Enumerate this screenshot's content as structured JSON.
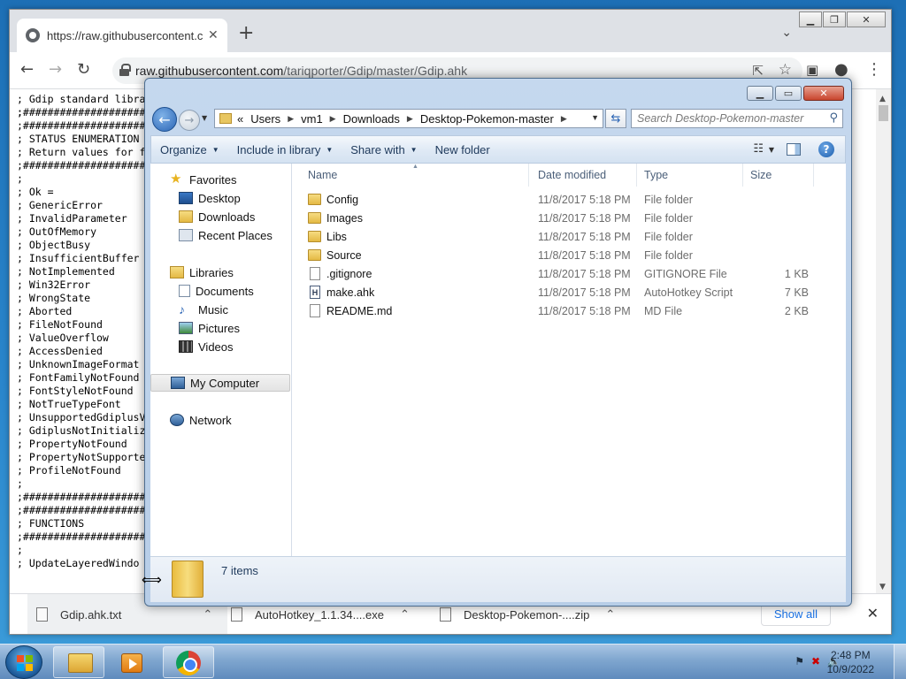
{
  "chrome": {
    "tab_title": "https://raw.githubusercontent.co",
    "url_host": "raw.githubusercontent.com",
    "url_path": "/tariqporter/Gdip/master/Gdip.ahk",
    "page_lines": [
      "; Gdip standard libra",
      ";",
      ";#####################",
      ";#####################",
      "; STATUS ENUMERATION",
      "; Return values for f",
      ";#####################",
      ";",
      "; Ok =",
      "; GenericError",
      "; InvalidParameter",
      "; OutOfMemory",
      "; ObjectBusy",
      "; InsufficientBuffer",
      "; NotImplemented",
      "; Win32Error",
      "; WrongState",
      "; Aborted",
      "; FileNotFound",
      "; ValueOverflow",
      "; AccessDenied",
      "; UnknownImageFormat",
      "; FontFamilyNotFound",
      "; FontStyleNotFound",
      "; NotTrueTypeFont",
      "; UnsupportedGdiplusV",
      "; GdiplusNotInitializ",
      "; PropertyNotFound",
      "; PropertyNotSupporte",
      "; ProfileNotFound",
      ";",
      ";#####################",
      ";#####################",
      "; FUNCTIONS",
      ";#####################",
      ";",
      "; UpdateLayeredWindo"
    ],
    "downloads": [
      {
        "name": "Gdip.ahk.txt"
      },
      {
        "name": "AutoHotkey_1.1.34....exe"
      },
      {
        "name": "Desktop-Pokemon-....zip"
      }
    ],
    "show_all": "Show all"
  },
  "explorer": {
    "breadcrumbs": [
      "Users",
      "vm1",
      "Downloads",
      "Desktop-Pokemon-master"
    ],
    "search_placeholder": "Search Desktop-Pokemon-master",
    "commands": {
      "organize": "Organize",
      "include": "Include in library",
      "share": "Share with",
      "new_folder": "New folder"
    },
    "nav": {
      "favorites": "Favorites",
      "desktop": "Desktop",
      "downloads": "Downloads",
      "recent": "Recent Places",
      "libraries": "Libraries",
      "documents": "Documents",
      "music": "Music",
      "pictures": "Pictures",
      "videos": "Videos",
      "computer": "My Computer",
      "network": "Network"
    },
    "columns": {
      "name": "Name",
      "date": "Date modified",
      "type": "Type",
      "size": "Size"
    },
    "files": [
      {
        "icon": "folder",
        "name": "Config",
        "date": "11/8/2017 5:18 PM",
        "type": "File folder",
        "size": ""
      },
      {
        "icon": "folder",
        "name": "Images",
        "date": "11/8/2017 5:18 PM",
        "type": "File folder",
        "size": ""
      },
      {
        "icon": "folder",
        "name": "Libs",
        "date": "11/8/2017 5:18 PM",
        "type": "File folder",
        "size": ""
      },
      {
        "icon": "folder",
        "name": "Source",
        "date": "11/8/2017 5:18 PM",
        "type": "File folder",
        "size": ""
      },
      {
        "icon": "file",
        "name": ".gitignore",
        "date": "11/8/2017 5:18 PM",
        "type": "GITIGNORE File",
        "size": "1 KB"
      },
      {
        "icon": "ahk",
        "name": "make.ahk",
        "date": "11/8/2017 5:18 PM",
        "type": "AutoHotkey Script",
        "size": "7 KB"
      },
      {
        "icon": "file",
        "name": "README.md",
        "date": "11/8/2017 5:18 PM",
        "type": "MD File",
        "size": "2 KB"
      }
    ],
    "item_count": "7 items"
  },
  "taskbar": {
    "time": "2:48 PM",
    "date": "10/9/2022"
  }
}
